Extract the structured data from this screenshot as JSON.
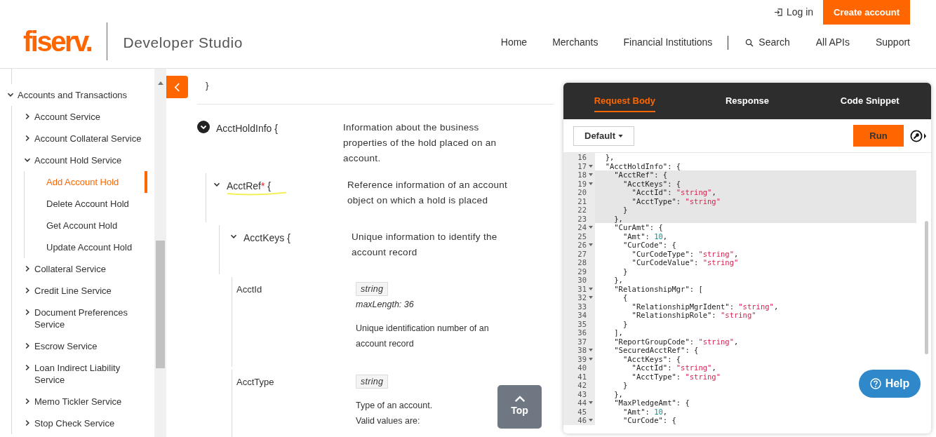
{
  "header": {
    "logo": "fiserv.",
    "product": "Developer Studio",
    "login": "Log in",
    "create_account": "Create account",
    "nav_primary": [
      {
        "label": "Home"
      },
      {
        "label": "Merchants"
      },
      {
        "label": "Financial Institutions"
      }
    ],
    "nav_secondary": [
      {
        "label": "Search",
        "kind": "search"
      },
      {
        "label": "All APIs",
        "kind": "link"
      },
      {
        "label": "Support",
        "kind": "link"
      }
    ]
  },
  "sidebar": {
    "items": [
      {
        "label": "Accounts and Transactions",
        "expanded": true,
        "selected": false,
        "children": [
          {
            "label": "Account Service",
            "expanded": false,
            "selected": false
          },
          {
            "label": "Account Collateral Service",
            "expanded": false,
            "selected": false
          },
          {
            "label": "Account Hold Service",
            "expanded": true,
            "selected": false,
            "children": [
              {
                "label": "Add Account Hold",
                "selected": true
              },
              {
                "label": "Delete Account Hold",
                "selected": false
              },
              {
                "label": "Get Account Hold",
                "selected": false
              },
              {
                "label": "Update Account Hold",
                "selected": false
              }
            ]
          },
          {
            "label": "Collateral Service",
            "expanded": false,
            "selected": false
          },
          {
            "label": "Credit Line Service",
            "expanded": false,
            "selected": false
          },
          {
            "label": "Document Preferences Service",
            "expanded": false,
            "selected": false
          },
          {
            "label": "Escrow Service",
            "expanded": false,
            "selected": false
          },
          {
            "label": "Loan Indirect Liability Service",
            "expanded": false,
            "selected": false
          },
          {
            "label": "Memo Tickler Service",
            "expanded": false,
            "selected": false
          },
          {
            "label": "Stop Check Service",
            "expanded": false,
            "selected": false
          }
        ]
      }
    ]
  },
  "schema": {
    "closing_brace": "}",
    "properties": [
      {
        "kind": "object",
        "name": "AcctHoldInfo {",
        "expanded": true,
        "highlighted": false,
        "description": "Information about the business properties of the hold placed on an account.",
        "children": [
          {
            "kind": "object",
            "name": "AcctRef",
            "required_mark": "*",
            "brace": " {",
            "expanded": true,
            "highlighted": true,
            "description": "Reference information of an account object on which a hold is placed",
            "children": [
              {
                "kind": "object",
                "name": "AcctKeys {",
                "expanded": true,
                "highlighted": false,
                "description": "Unique information to identify the account record",
                "children": [
                  {
                    "kind": "field",
                    "name": "AcctId",
                    "type": "string",
                    "max_length": "maxLength: 36",
                    "description": "Unique identification number of an account record"
                  },
                  {
                    "kind": "field",
                    "name": "AcctType",
                    "type": "string",
                    "description": "Type of an account.\nValid values are:"
                  }
                ]
              }
            ]
          }
        ]
      }
    ]
  },
  "top_button": "Top",
  "panel": {
    "tabs": [
      {
        "label": "Request Body",
        "selected": true
      },
      {
        "label": "Response",
        "selected": false
      },
      {
        "label": "Code Snippet",
        "selected": false
      }
    ],
    "example_select": "Default",
    "run": "Run",
    "code": [
      {
        "number": "16",
        "foldable": false,
        "highlighted": false,
        "text": "  },"
      },
      {
        "number": "17",
        "foldable": true,
        "highlighted": false,
        "text": "  \"AcctHoldInfo\": {"
      },
      {
        "number": "18",
        "foldable": true,
        "highlighted": true,
        "text": "    \"AcctRef\": {"
      },
      {
        "number": "19",
        "foldable": true,
        "highlighted": true,
        "text": "      \"AcctKeys\": {"
      },
      {
        "number": "20",
        "foldable": false,
        "highlighted": true,
        "text": "        \"AcctId\": ",
        "value": "\"string\"",
        "kind": "string",
        "tail": ","
      },
      {
        "number": "21",
        "foldable": false,
        "highlighted": true,
        "text": "        \"AcctType\": ",
        "value": "\"string\"",
        "kind": "string"
      },
      {
        "number": "22",
        "foldable": false,
        "highlighted": true,
        "text": "      }"
      },
      {
        "number": "23",
        "foldable": false,
        "highlighted": true,
        "text": "    },"
      },
      {
        "number": "24",
        "foldable": true,
        "highlighted": false,
        "text": "    \"CurAmt\": {"
      },
      {
        "number": "25",
        "foldable": false,
        "highlighted": false,
        "text": "      \"Amt\": ",
        "value": "10",
        "kind": "number",
        "tail": ","
      },
      {
        "number": "26",
        "foldable": true,
        "highlighted": false,
        "text": "      \"CurCode\": {"
      },
      {
        "number": "27",
        "foldable": false,
        "highlighted": false,
        "text": "        \"CurCodeType\": ",
        "value": "\"string\"",
        "kind": "string",
        "tail": ","
      },
      {
        "number": "28",
        "foldable": false,
        "highlighted": false,
        "text": "        \"CurCodeValue\": ",
        "value": "\"string\"",
        "kind": "string"
      },
      {
        "number": "29",
        "foldable": false,
        "highlighted": false,
        "text": "      }"
      },
      {
        "number": "30",
        "foldable": false,
        "highlighted": false,
        "text": "    },"
      },
      {
        "number": "31",
        "foldable": true,
        "highlighted": false,
        "text": "    \"RelationshipMgr\": ["
      },
      {
        "number": "32",
        "foldable": true,
        "highlighted": false,
        "text": "      {"
      },
      {
        "number": "33",
        "foldable": false,
        "highlighted": false,
        "text": "        \"RelationshipMgrIdent\": ",
        "value": "\"string\"",
        "kind": "string",
        "tail": ","
      },
      {
        "number": "34",
        "foldable": false,
        "highlighted": false,
        "text": "        \"RelationshipRole\": ",
        "value": "\"string\"",
        "kind": "string"
      },
      {
        "number": "35",
        "foldable": false,
        "highlighted": false,
        "text": "      }"
      },
      {
        "number": "36",
        "foldable": false,
        "highlighted": false,
        "text": "    ],"
      },
      {
        "number": "37",
        "foldable": false,
        "highlighted": false,
        "text": "    \"ReportGroupCode\": ",
        "value": "\"string\"",
        "kind": "string",
        "tail": ","
      },
      {
        "number": "38",
        "foldable": true,
        "highlighted": false,
        "text": "    \"SecuredAcctRef\": {"
      },
      {
        "number": "39",
        "foldable": true,
        "highlighted": false,
        "text": "      \"AcctKeys\": {"
      },
      {
        "number": "40",
        "foldable": false,
        "highlighted": false,
        "text": "        \"AcctId\": ",
        "value": "\"string\"",
        "kind": "string",
        "tail": ","
      },
      {
        "number": "41",
        "foldable": false,
        "highlighted": false,
        "text": "        \"AcctType\": ",
        "value": "\"string\"",
        "kind": "string"
      },
      {
        "number": "42",
        "foldable": false,
        "highlighted": false,
        "text": "      }"
      },
      {
        "number": "43",
        "foldable": false,
        "highlighted": false,
        "text": "    },"
      },
      {
        "number": "44",
        "foldable": true,
        "highlighted": false,
        "text": "    \"MaxPledgeAmt\": {"
      },
      {
        "number": "45",
        "foldable": false,
        "highlighted": false,
        "text": "      \"Amt\": ",
        "value": "10",
        "kind": "number",
        "tail": ","
      },
      {
        "number": "46",
        "foldable": true,
        "highlighted": false,
        "text": "      \"CurCode\": {"
      }
    ],
    "help": "Help"
  }
}
